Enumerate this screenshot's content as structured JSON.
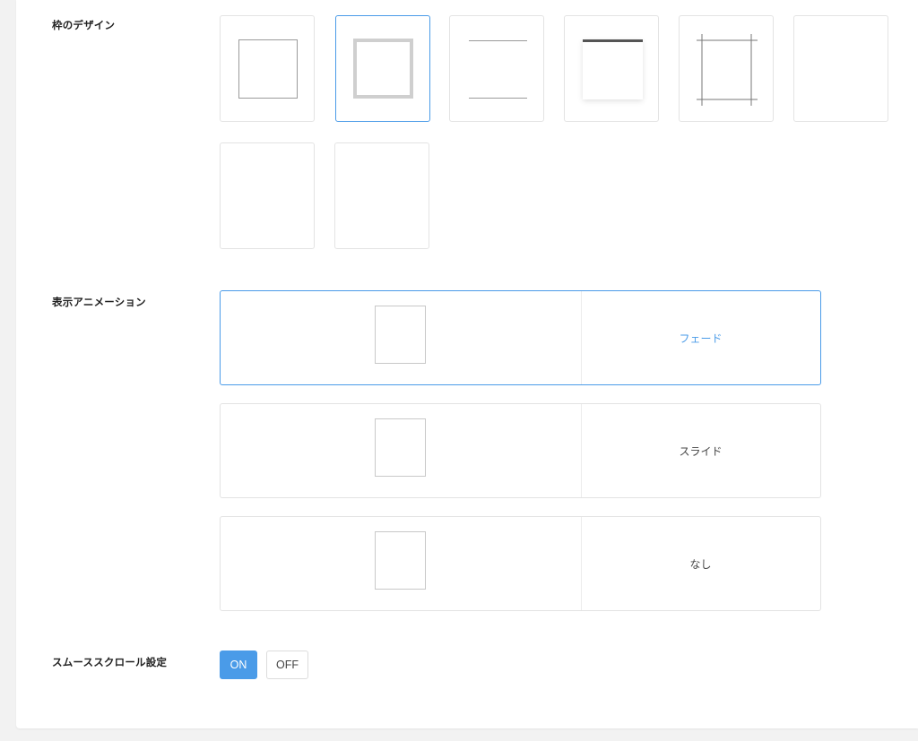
{
  "frame_design": {
    "label": "枠のデザイン",
    "options": [
      {
        "name": "frame-option-thin-border",
        "selected": false
      },
      {
        "name": "frame-option-thick-border",
        "selected": true
      },
      {
        "name": "frame-option-top-bottom-lines",
        "selected": false
      },
      {
        "name": "frame-option-top-bar-shadow",
        "selected": false
      },
      {
        "name": "frame-option-crop-marks",
        "selected": false
      },
      {
        "name": "frame-option-blank-1",
        "selected": false
      },
      {
        "name": "frame-option-blank-2",
        "selected": false
      },
      {
        "name": "frame-option-blank-3",
        "selected": false
      }
    ]
  },
  "display_animation": {
    "label": "表示アニメーション",
    "options": [
      {
        "label": "フェード",
        "selected": true
      },
      {
        "label": "スライド",
        "selected": false
      },
      {
        "label": "なし",
        "selected": false
      }
    ]
  },
  "smooth_scroll": {
    "label": "スムーススクロール設定",
    "on_label": "ON",
    "off_label": "OFF",
    "value": "ON"
  },
  "colors": {
    "accent": "#4a9be8",
    "border": "#e3e3e3",
    "background": "#f2f2f2"
  }
}
